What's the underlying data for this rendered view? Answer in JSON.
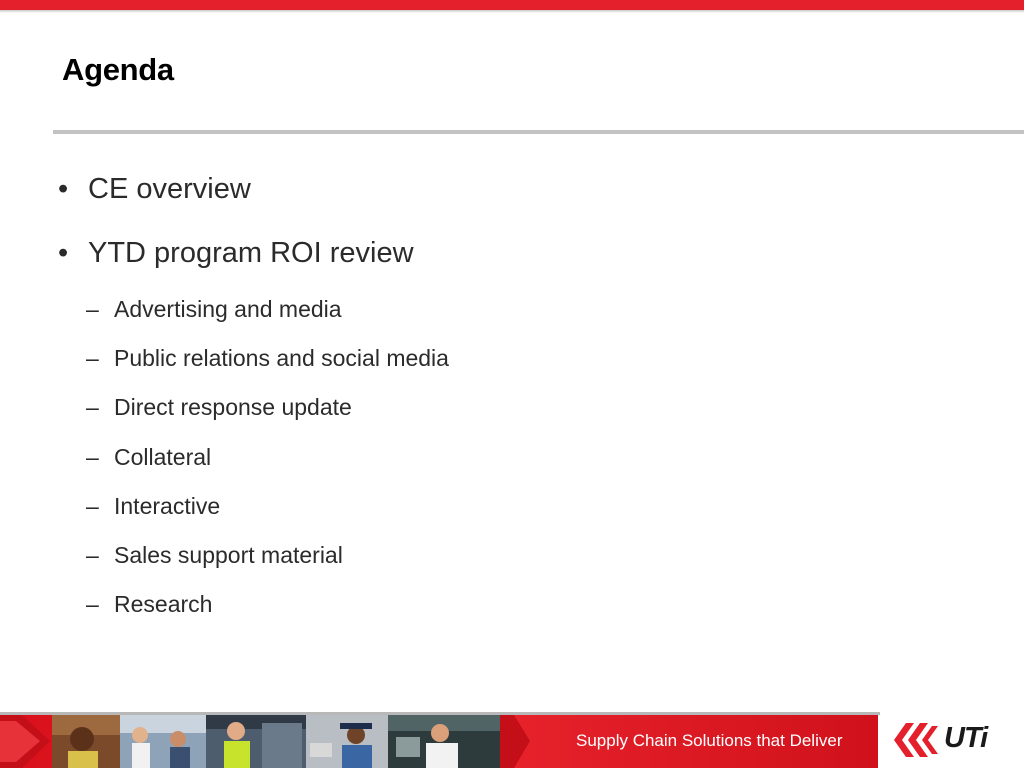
{
  "slide": {
    "title": "Agenda",
    "bullets": [
      {
        "text": "CE overview",
        "marker": "•"
      },
      {
        "text": "YTD program ROI review",
        "marker": "•"
      }
    ],
    "sub_bullets": [
      {
        "text": "Advertising and media",
        "marker": "–"
      },
      {
        "text": "Public relations and social media",
        "marker": "–"
      },
      {
        "text": "Direct response update",
        "marker": "–"
      },
      {
        "text": "Collateral",
        "marker": "–"
      },
      {
        "text": "Interactive",
        "marker": "–"
      },
      {
        "text": "Sales support material",
        "marker": "–"
      },
      {
        "text": "Research",
        "marker": "–"
      }
    ]
  },
  "footer": {
    "tagline": "Supply Chain Solutions that Deliver",
    "logo_text": "UTi",
    "brand_color": "#e3202b"
  },
  "icons": [
    "uti-logo-mark-icon",
    "photo-strip-image"
  ]
}
